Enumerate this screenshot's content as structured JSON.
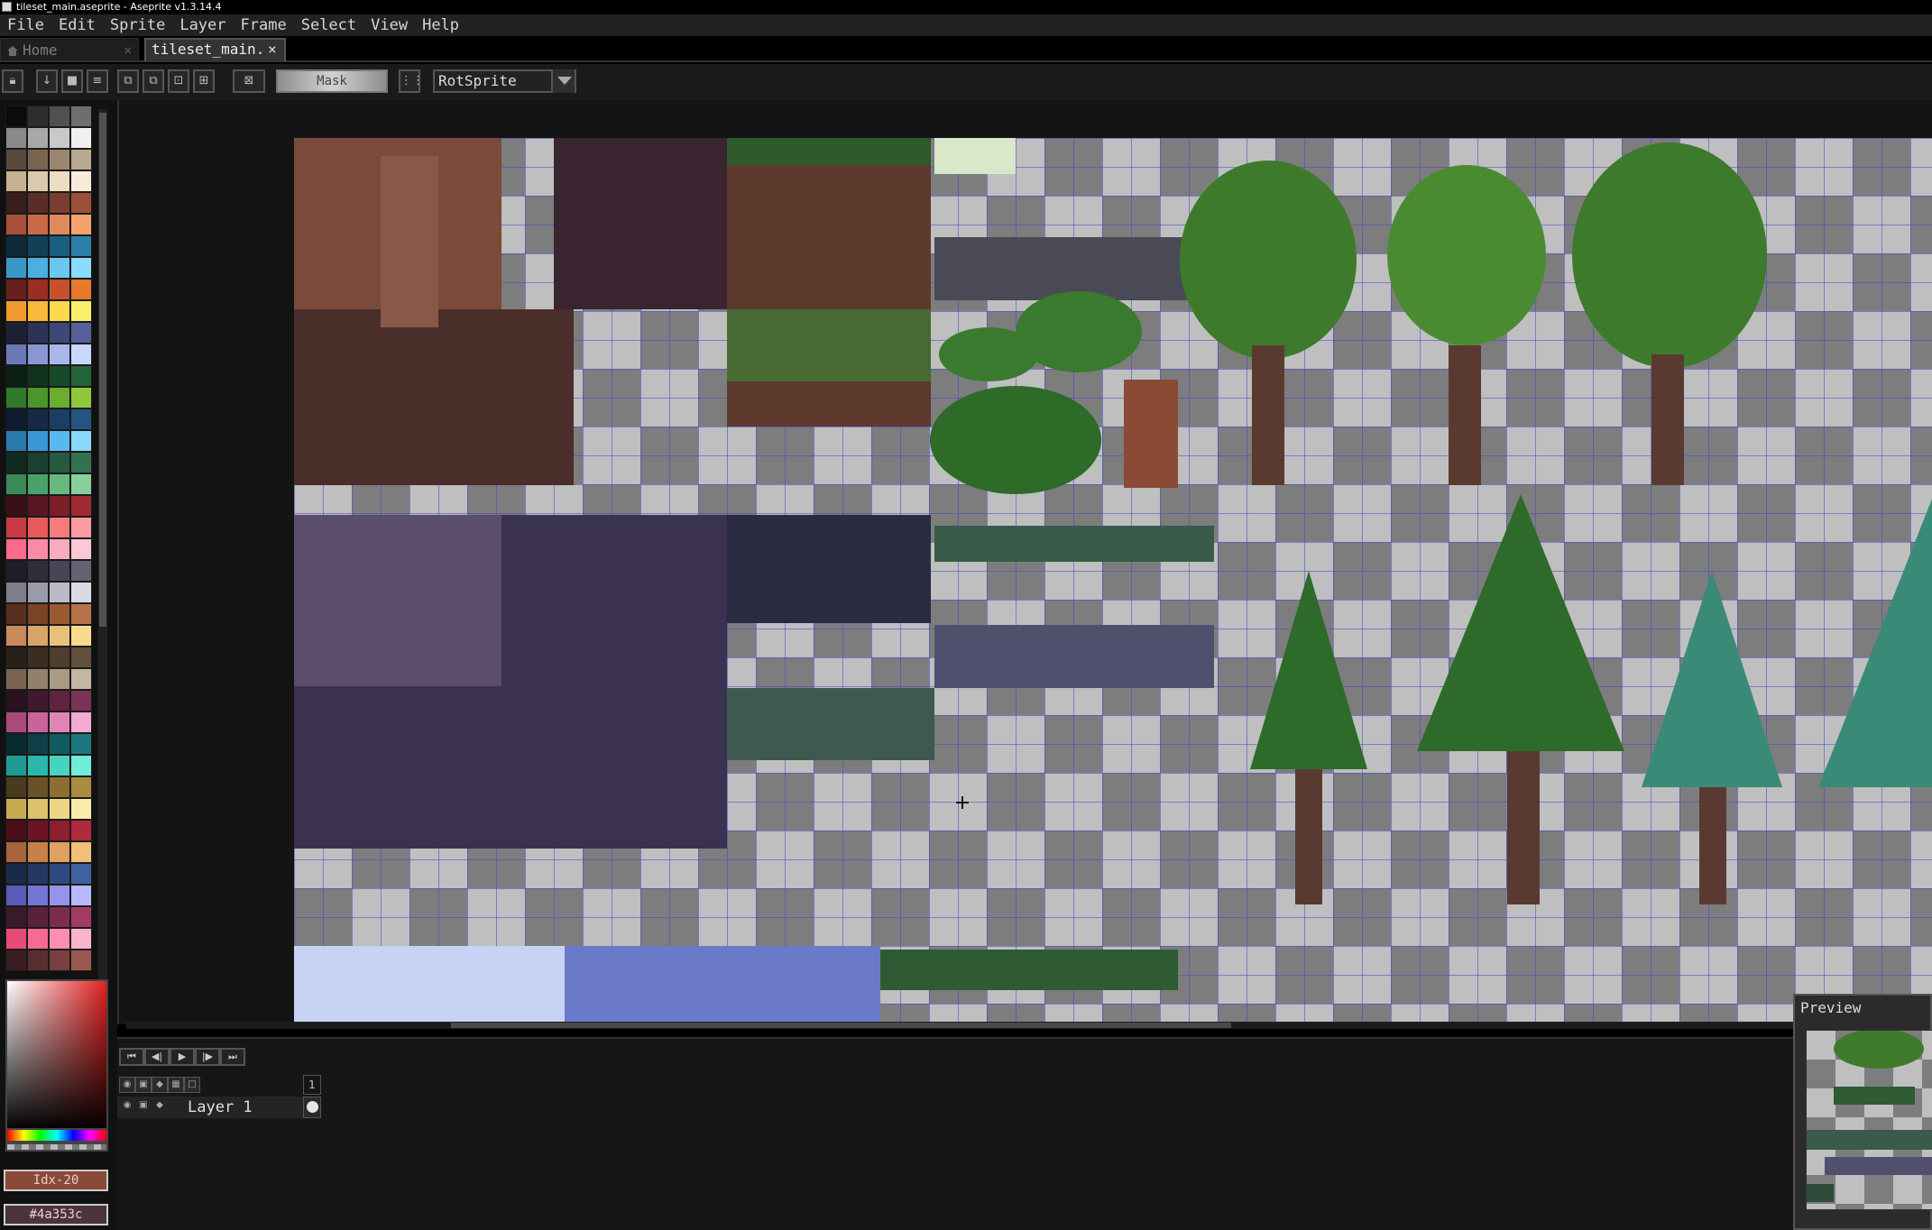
{
  "window": {
    "title": "tileset_main.aseprite - Aseprite v1.3.14.4"
  },
  "menu": [
    "File",
    "Edit",
    "Sprite",
    "Layer",
    "Frame",
    "Select",
    "View",
    "Help"
  ],
  "tabs": {
    "home": {
      "label": "Home",
      "close": "×"
    },
    "file": {
      "label": "tileset_main.aseprite",
      "close": "×"
    }
  },
  "toolbar": {
    "mask_label": "Mask",
    "resize_method": "RotSprite",
    "icons": [
      "lock-icon",
      "down-arrow-icon",
      "stop-icon",
      "menu-lines-icon",
      "copy-selection-icon",
      "duplicate-icon",
      "intersect-icon",
      "grid-icon",
      "pixel-perfect-icon",
      "dotted-grid-icon"
    ]
  },
  "palette": {
    "colors": [
      "#0b0b0b",
      "#2e2e2e",
      "#505050",
      "#6e6e6e",
      "#8a8a8a",
      "#a8a8a8",
      "#c9c9c9",
      "#f0f0f0",
      "#5a4a3e",
      "#7a6550",
      "#9a8570",
      "#b8a890",
      "#c8b090",
      "#dcc8aa",
      "#ecdcc0",
      "#f8ecd8",
      "#3a1e1e",
      "#5a2e28",
      "#7a3e30",
      "#9a5038",
      "#a85038",
      "#c86a48",
      "#e08a5a",
      "#f4a46a",
      "#0c2a38",
      "#124058",
      "#1a5e80",
      "#2a80a8",
      "#3a98c8",
      "#4ab0e0",
      "#6ac8f0",
      "#8adcfc",
      "#6a1e1e",
      "#9a2e22",
      "#c8502a",
      "#e8782a",
      "#f09a30",
      "#f8b83a",
      "#fcd84a",
      "#fcf06a",
      "#1e2038",
      "#2e3258",
      "#3e4878",
      "#56609a",
      "#6a78b8",
      "#8898d4",
      "#a8b8ec",
      "#c8d8fc",
      "#0a2014",
      "#10321e",
      "#184a2a",
      "#226438",
      "#2e7a2a",
      "#4a962a",
      "#6aae30",
      "#8ec83a",
      "#0e1a2e",
      "#142a46",
      "#1c3e62",
      "#265480",
      "#2a7ab0",
      "#3a98d8",
      "#5ab8f0",
      "#8ad8fc",
      "#102a20",
      "#1a4030",
      "#265a40",
      "#327250",
      "#3a8a58",
      "#4aa26a",
      "#66ba80",
      "#88d09a",
      "#3a0e16",
      "#5a1620",
      "#7e1e28",
      "#a02a32",
      "#c83a44",
      "#e85a5a",
      "#f87a7a",
      "#fc9ca0",
      "#fc6a8a",
      "#fc8aa6",
      "#fcaac0",
      "#fcc8d8",
      "#1e1e28",
      "#2e2e3a",
      "#464656",
      "#626272",
      "#7e7e8e",
      "#9a9aaa",
      "#babac8",
      "#dadae4",
      "#5a2e1e",
      "#7a4226",
      "#9a5a32",
      "#b8724a",
      "#c88a5a",
      "#d8a46a",
      "#e8c07a",
      "#f8dc8e",
      "#2a2018",
      "#3a2e22",
      "#4e3e2e",
      "#62503c",
      "#7a6650",
      "#92806a",
      "#aa9a84",
      "#c4b6a0",
      "#2a1020",
      "#42182e",
      "#5e2440",
      "#7a3256",
      "#aa4a7a",
      "#c8649a",
      "#e084b8",
      "#f4a8d4",
      "#082a30",
      "#0e3e48",
      "#125a62",
      "#1a787e",
      "#1e9a94",
      "#2ab8aa",
      "#44d4c0",
      "#70ecd8",
      "#4a3a1e",
      "#6a5226",
      "#8a6e32",
      "#aa8c40",
      "#c8aa52",
      "#dcc268",
      "#ecd884",
      "#f8eca8",
      "#4a0e1a",
      "#6a1424",
      "#8e1e30",
      "#b02a3c",
      "#a8643a",
      "#c8804a",
      "#e0a05e",
      "#f0c078",
      "#1a2a4a",
      "#223862",
      "#2e4a80",
      "#3e62a0",
      "#5a5ab8",
      "#7474d4",
      "#9494ec",
      "#b8b8fc",
      "#3a1a2a",
      "#5a223a",
      "#7e2c4e",
      "#a23a64",
      "#e84a78",
      "#f86a92",
      "#fc8eb0",
      "#fcb4cc",
      "#3a1e24",
      "#5a2e30",
      "#7a403e",
      "#9a5850"
    ]
  },
  "colors": {
    "fg_label": "Idx-20",
    "bg_label": "#4a353c"
  },
  "timeline": {
    "buttons": [
      "⏮",
      "◀|",
      "▶",
      "|▶",
      "⏭"
    ],
    "frame_number": "1",
    "layers": [
      {
        "name": "Layer 1"
      }
    ]
  },
  "preview": {
    "title": "Preview"
  }
}
